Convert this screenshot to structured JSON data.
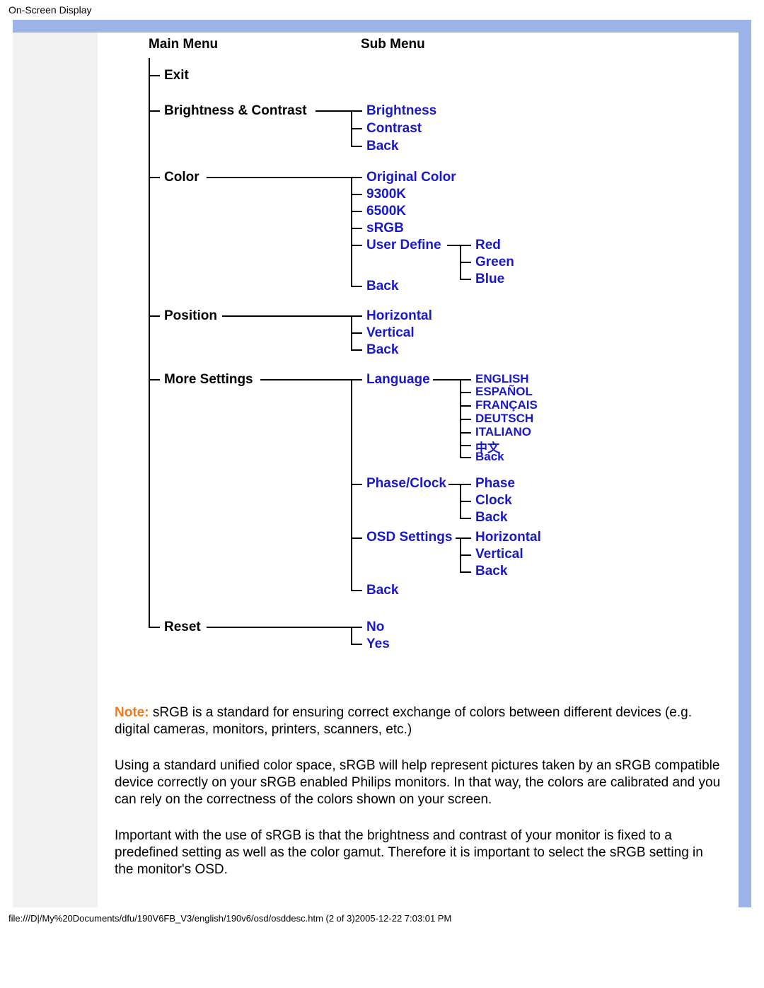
{
  "header": {
    "title": "On-Screen Display"
  },
  "diagram": {
    "col_titles": {
      "main": "Main Menu",
      "sub": "Sub Menu"
    },
    "main": {
      "exit": "Exit",
      "bright_contrast": "Brightness & Contrast",
      "color": "Color",
      "position": "Position",
      "more_settings": "More Settings",
      "reset": "Reset"
    },
    "sub": {
      "brightness": "Brightness",
      "contrast": "Contrast",
      "back": "Back",
      "original_color": "Original Color",
      "k9300": "9300K",
      "k6500": "6500K",
      "srgb": "sRGB",
      "user_define": "User Define",
      "horizontal": "Horizontal",
      "vertical": "Vertical",
      "language": "Language",
      "phase_clock": "Phase/Clock",
      "osd_settings": "OSD Settings",
      "no": "No",
      "yes": "Yes"
    },
    "tert": {
      "red": "Red",
      "green": "Green",
      "blue": "Blue",
      "english": "ENGLISH",
      "espanol": "ESPAÑOL",
      "francais": "FRANÇAIS",
      "deutsch": "DEUTSCH",
      "italiano": "ITALIANO",
      "zhongwen": "中文",
      "back": "Back",
      "phase": "Phase",
      "clock": "Clock",
      "horizontal": "Horizontal",
      "vertical": "Vertical"
    }
  },
  "paragraphs": {
    "note_label": "Note:",
    "note_rest": " sRGB is a standard for ensuring correct exchange of colors between different devices (e.g. digital cameras, monitors, printers, scanners, etc.)",
    "p2": "Using a standard unified color space, sRGB will help represent pictures taken by an sRGB compatible device correctly on your sRGB enabled Philips monitors. In that way, the colors are calibrated and you can rely on the correctness of the colors shown on your screen.",
    "p3": "Important with the use of sRGB is that the brightness and contrast of your monitor is fixed to a predefined setting as well as the color gamut. Therefore it is important to select the sRGB setting in the monitor's OSD."
  },
  "footer": {
    "text": "file:///D|/My%20Documents/dfu/190V6FB_V3/english/190v6/osd/osddesc.htm (2 of 3)2005-12-22 7:03:01 PM"
  }
}
